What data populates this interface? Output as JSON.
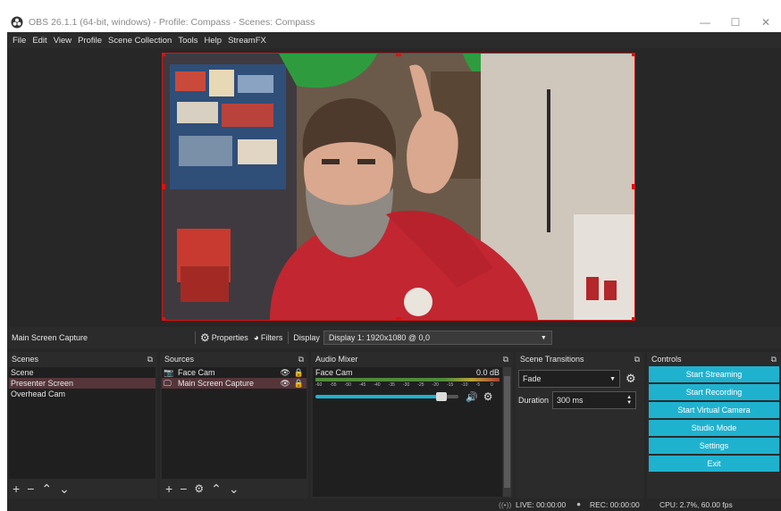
{
  "window": {
    "title": "OBS 26.1.1 (64-bit, windows) - Profile: Compass - Scenes: Compass",
    "minimize": "—",
    "maximize": "☐",
    "close": "✕"
  },
  "menu": [
    "File",
    "Edit",
    "View",
    "Profile",
    "Scene Collection",
    "Tools",
    "Help",
    "StreamFX"
  ],
  "context_bar": {
    "source_name": "Main Screen Capture",
    "properties_label": "Properties",
    "filters_label": "Filters",
    "display_label": "Display",
    "display_value": "Display 1: 1920x1080 @ 0,0"
  },
  "scenes": {
    "title": "Scenes",
    "items": [
      "Scene",
      "Presenter Screen",
      "Overhead Cam"
    ],
    "selected_index": 1
  },
  "sources": {
    "title": "Sources",
    "items": [
      {
        "label": "Face Cam",
        "icon": "camera-icon"
      },
      {
        "label": "Main Screen Capture",
        "icon": "monitor-icon"
      }
    ],
    "selected_index": 1
  },
  "audio_mixer": {
    "title": "Audio Mixer",
    "channel_name": "Face Cam",
    "level": "0.0 dB",
    "scale": [
      "-60",
      "-55",
      "-50",
      "-45",
      "-40",
      "-35",
      "-30",
      "-25",
      "-20",
      "-15",
      "-10",
      "-5",
      "0"
    ],
    "volume_fraction": 0.92
  },
  "transitions": {
    "title": "Scene Transitions",
    "selected": "Fade",
    "duration_label": "Duration",
    "duration_value": "300 ms"
  },
  "controls": {
    "title": "Controls",
    "buttons": [
      "Start Streaming",
      "Start Recording",
      "Start Virtual Camera",
      "Studio Mode",
      "Settings",
      "Exit"
    ]
  },
  "status": {
    "live": "LIVE: 00:00:00",
    "rec": "REC: 00:00:00",
    "cpu": "CPU: 2.7%, 60.00 fps"
  },
  "colors": {
    "accent": "#1fb2cf",
    "selection_border": "#e01010",
    "selected_row": "#55353a"
  }
}
